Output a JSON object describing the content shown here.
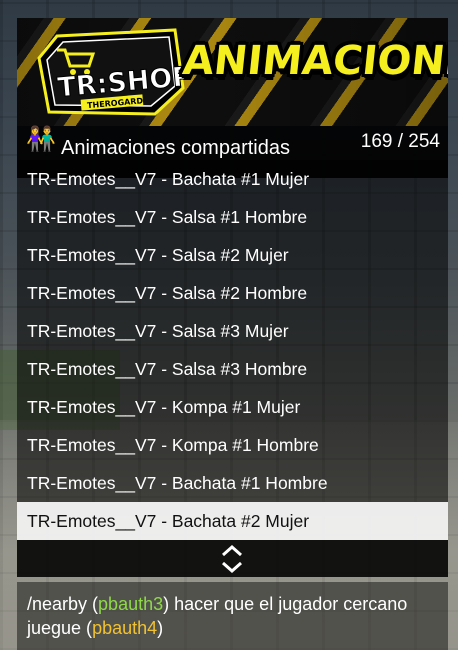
{
  "banner": {
    "logo_text": "TR:SHOP",
    "logo_subtext": "THEROGARD",
    "title": "ANIMACIONES"
  },
  "header": {
    "icon": "people-pair-icon",
    "title": "Animaciones compartidas",
    "counter": "169 / 254"
  },
  "menu": {
    "items": [
      {
        "label": "TR-Emotes__V7 - Bachata #1 Mujer",
        "selected": false
      },
      {
        "label": "TR-Emotes__V7 - Salsa #1 Hombre",
        "selected": false
      },
      {
        "label": "TR-Emotes__V7 - Salsa #2 Mujer",
        "selected": false
      },
      {
        "label": "TR-Emotes__V7 - Salsa #2 Hombre",
        "selected": false
      },
      {
        "label": "TR-Emotes__V7 - Salsa #3 Mujer",
        "selected": false
      },
      {
        "label": "TR-Emotes__V7 - Salsa #3 Hombre",
        "selected": false
      },
      {
        "label": "TR-Emotes__V7 - Kompa #1 Mujer",
        "selected": false
      },
      {
        "label": "TR-Emotes__V7 - Kompa #1 Hombre",
        "selected": false
      },
      {
        "label": "TR-Emotes__V7 - Bachata #1 Hombre",
        "selected": false
      },
      {
        "label": "TR-Emotes__V7 - Bachata #2 Mujer",
        "selected": true
      }
    ],
    "scroll_icon": "up-down-chevron-icon"
  },
  "description": {
    "part1": "/nearby (",
    "arg1": "pbauth3",
    "part2": ") hacer que el jugador cercano juegue (",
    "arg2": "pbauth4",
    "part3": ")"
  },
  "colors": {
    "title_yellow": "#f5ef1f",
    "selected_bg": "#f0f0f0",
    "arg_green": "#8fd84a",
    "arg_yellow": "#f2c230"
  }
}
